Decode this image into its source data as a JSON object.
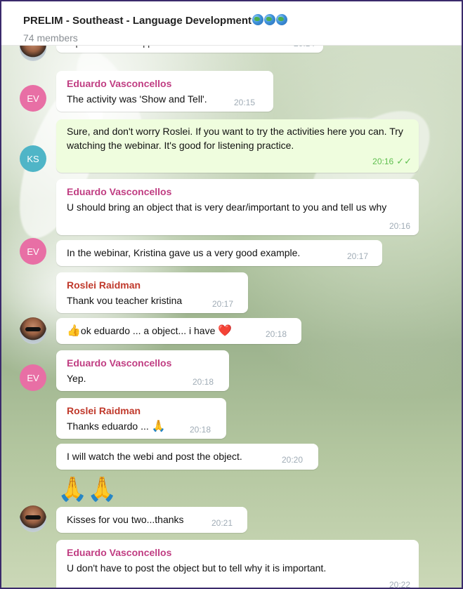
{
  "header": {
    "title": "PRELIM - Southeast - Language Development",
    "title_globes": [
      "earth-americas-icon",
      "earth-africa-icon",
      "earth-americas-icon"
    ],
    "members": "74 members"
  },
  "messages": [
    {
      "id": "m0",
      "text": "A primeira coisa q preciso fazer entao... ???",
      "time": "20:14"
    },
    {
      "id": "m1",
      "sender": "Eduardo Vasconcellos",
      "avatar": "EV",
      "text": "The activity was 'Show and Tell'.",
      "time": "20:15"
    },
    {
      "id": "m2",
      "avatar": "KS",
      "text": "Sure, and don't worry Roslei. If you want to try the activities here you can. Try watching the webinar. It's good for listening practice.",
      "time": "20:16",
      "read": "✓✓"
    },
    {
      "id": "m3",
      "sender": "Eduardo Vasconcellos",
      "text": "U should bring an object that is very dear/important to you and tell us why",
      "time": "20:16"
    },
    {
      "id": "m4",
      "avatar": "EV",
      "text": "In the webinar, Kristina gave us a very good example.",
      "time": "20:17"
    },
    {
      "id": "m5",
      "sender": "Roslei Raidman",
      "text": "Thank vou teacher kristina",
      "time": "20:17"
    },
    {
      "id": "m6",
      "avatar": "photo",
      "emoji_before": "👍",
      "text": "ok eduardo ... a object... i have",
      "emoji_after": "❤️",
      "time": "20:18"
    },
    {
      "id": "m7",
      "sender": "Eduardo Vasconcellos",
      "avatar": "EV",
      "text": "Yep.",
      "time": "20:18"
    },
    {
      "id": "m8",
      "sender": "Roslei Raidman",
      "text": "Thanks eduardo ...",
      "emoji_after": "🙏",
      "time": "20:18"
    },
    {
      "id": "m9",
      "text": "I will watch the webi and post the object.",
      "time": "20:20"
    },
    {
      "id": "m10",
      "big_emoji": "🙏🙏"
    },
    {
      "id": "m11",
      "avatar": "photo",
      "text": "Kisses for vou two...thanks",
      "time": "20:21"
    },
    {
      "id": "m12",
      "sender": "Eduardo Vasconcellos",
      "text": "U don't have to post the object but to tell why it is important.",
      "time": "20:22"
    }
  ]
}
